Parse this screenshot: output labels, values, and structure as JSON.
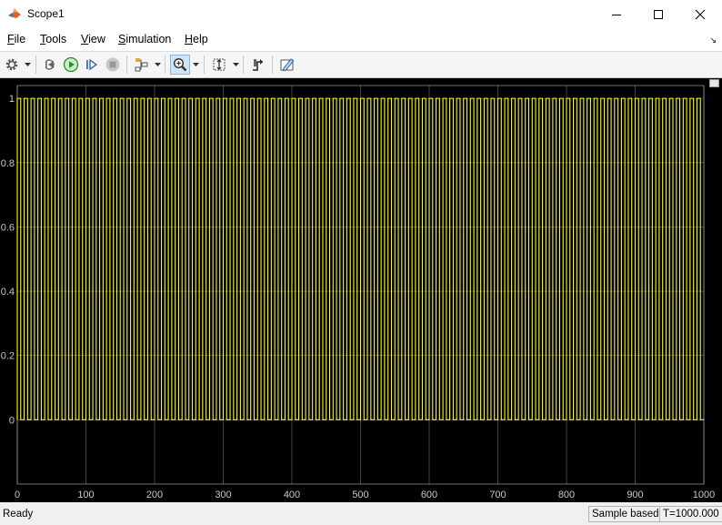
{
  "window": {
    "title": "Scope1"
  },
  "menu": [
    {
      "key": "F",
      "rest": "ile"
    },
    {
      "key": "T",
      "rest": "ools"
    },
    {
      "key": "V",
      "rest": "iew"
    },
    {
      "key": "S",
      "rest": "imulation"
    },
    {
      "key": "H",
      "rest": "elp"
    }
  ],
  "toolbar": {
    "icons": [
      "gear-icon",
      "step-back-icon",
      "run-icon",
      "step-forward-icon",
      "stop-icon",
      "highlight-signal-icon",
      "zoom-icon",
      "scale-axes-icon",
      "trigger-icon",
      "legend-pencil-icon"
    ]
  },
  "status": {
    "left": "Ready",
    "mode": "Sample based",
    "time": "T=1000.000"
  },
  "colors": {
    "signal": "#ffff00",
    "grid": "#c8c8c8",
    "background": "#000000",
    "axis_text": "#c8c8c8"
  },
  "chart_data": {
    "type": "line",
    "title": "",
    "xlabel": "",
    "ylabel": "",
    "xlim": [
      0,
      1000
    ],
    "ylim": [
      -0.2,
      1.04
    ],
    "xticks": [
      0,
      100,
      200,
      300,
      400,
      500,
      600,
      700,
      800,
      900,
      1000
    ],
    "yticks": [
      0,
      0.2,
      0.4,
      0.6,
      0.8,
      1
    ],
    "grid": true,
    "series": [
      {
        "signal": "pulse",
        "period": 10,
        "duty": 0.5,
        "low": 0,
        "high": 1,
        "x_start": 0,
        "x_end": 1000
      }
    ]
  }
}
